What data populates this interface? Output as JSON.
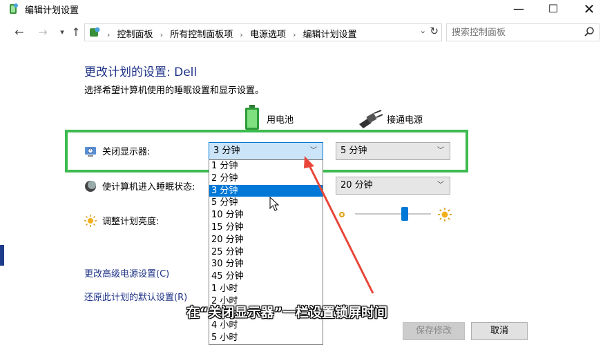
{
  "window": {
    "title": "编辑计划设置",
    "min_icon": "minimize-icon",
    "max_icon": "maximize-icon",
    "close_icon": "close-icon"
  },
  "address": {
    "breadcrumbs": [
      "控制面板",
      "所有控制面板项",
      "电源选项",
      "编辑计划设置"
    ],
    "search_placeholder": "搜索控制面板"
  },
  "main": {
    "heading": "更改计划的设置: Dell",
    "subheading": "选择希望计算机使用的睡眠设置和显示设置。",
    "columns": {
      "battery": "用电池",
      "plugged_in": "接通电源"
    },
    "rows": {
      "display_off": {
        "label": "关闭显示器:",
        "battery_value": "3 分钟",
        "plugged_value": "5 分钟"
      },
      "sleep": {
        "label": "使计算机进入睡眠状态:",
        "plugged_value": "20 分钟"
      },
      "brightness": {
        "label": "调整计划亮度:",
        "plugged_level_percent": 65
      }
    },
    "dropdown_options": [
      "1 分钟",
      "2 分钟",
      "3 分钟",
      "5 分钟",
      "10 分钟",
      "15 分钟",
      "20 分钟",
      "25 分钟",
      "30 分钟",
      "45 分钟",
      "1 小时",
      "2 小时",
      "3 小时",
      "4 小时",
      "5 小时"
    ],
    "dropdown_selected": "3 分钟",
    "links": {
      "advanced": "更改高级电源设置(C)",
      "restore": "还原此计划的默认设置(R)"
    },
    "buttons": {
      "save": "保存修改",
      "cancel": "取消"
    }
  },
  "overlay": {
    "caption": "在“关闭显示器”一栏设置锁屏时间",
    "highlight_color": "#3dbb4f",
    "arrow_color": "#e8463a"
  },
  "colors": {
    "accent": "#0078d7",
    "heading_blue": "#1e3287"
  }
}
